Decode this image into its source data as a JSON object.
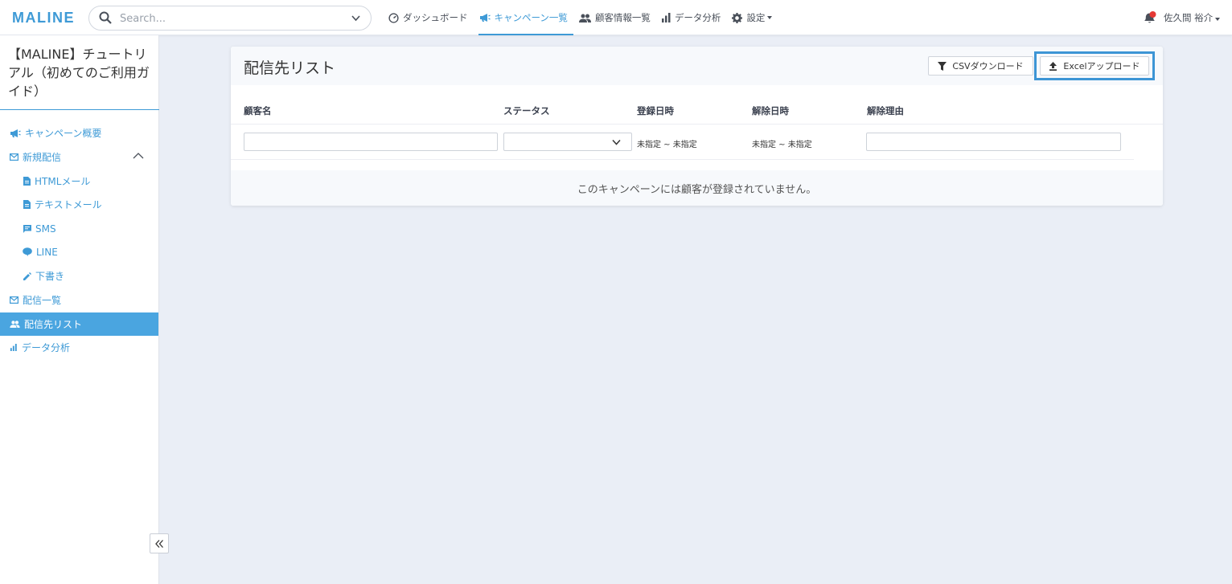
{
  "header": {
    "logo": "MALINE",
    "search_placeholder": "Search...",
    "nav": [
      {
        "label": "ダッシュボード",
        "icon": "gauge-icon"
      },
      {
        "label": "キャンペーン一覧",
        "icon": "megaphone-icon",
        "active": true
      },
      {
        "label": "顧客情報一覧",
        "icon": "people-icon"
      },
      {
        "label": "データ分析",
        "icon": "bar-chart-icon"
      },
      {
        "label": "設定",
        "icon": "gear-icon"
      }
    ],
    "user_name": "佐久間 裕介",
    "accent_color": "#3e9ad6",
    "notification_dot_color": "#e53935"
  },
  "sidebar": {
    "campaign_title": "【MALINE】チュートリアル（初めてのご利用ガイド）",
    "items": [
      {
        "label": "キャンペーン概要",
        "icon": "megaphone-icon"
      },
      {
        "label": "新規配信",
        "icon": "mail-icon",
        "expanded": true
      },
      {
        "label": "HTMLメール",
        "icon": "document-icon"
      },
      {
        "label": "テキストメール",
        "icon": "document-icon"
      },
      {
        "label": "SMS",
        "icon": "message-icon"
      },
      {
        "label": "LINE",
        "icon": "chat-bubble-icon"
      },
      {
        "label": "下書き",
        "icon": "pencil-icon"
      },
      {
        "label": "配信一覧",
        "icon": "mail-icon"
      },
      {
        "label": "配信先リスト",
        "icon": "people-icon",
        "active": true
      },
      {
        "label": "データ分析",
        "icon": "bar-chart-icon"
      }
    ]
  },
  "main": {
    "title": "配信先リスト",
    "csv_button": "CSVダウンロード",
    "excel_button": "Excelアップロード",
    "columns": [
      "顧客名",
      "ステータス",
      "登録日時",
      "解除日時",
      "解除理由"
    ],
    "registered_range": "未指定 ~ 未指定",
    "cancelled_range": "未指定 ~ 未指定",
    "empty_message": "このキャンペーンには顧客が登録されていません。"
  }
}
